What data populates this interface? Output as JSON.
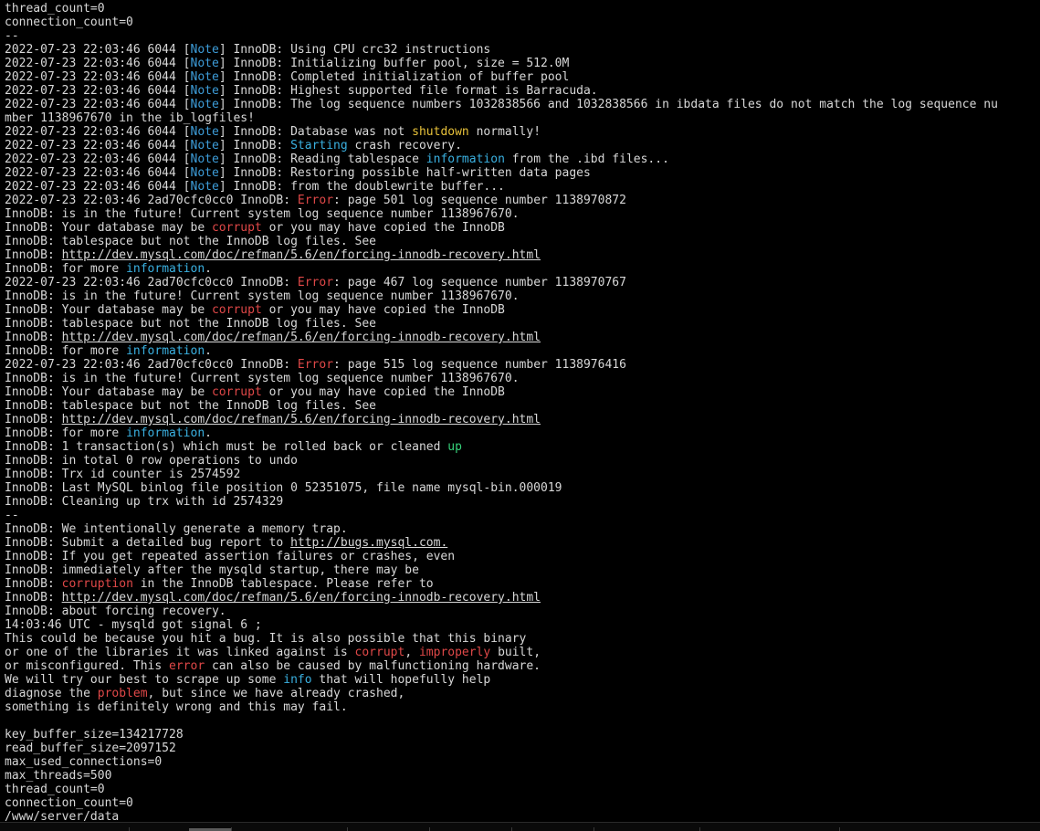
{
  "terminal": {
    "lines": [
      [
        {
          "t": "thread_count=0"
        }
      ],
      [
        {
          "t": "connection_count=0"
        }
      ],
      [
        {
          "t": "--"
        }
      ],
      [
        {
          "t": "2022-07-23 22:03:46 6044 ["
        },
        {
          "t": "Note",
          "c": "note"
        },
        {
          "t": "] InnoDB: Using CPU crc32 instructions"
        }
      ],
      [
        {
          "t": "2022-07-23 22:03:46 6044 ["
        },
        {
          "t": "Note",
          "c": "note"
        },
        {
          "t": "] InnoDB: Initializing buffer pool, size = 512.0M"
        }
      ],
      [
        {
          "t": "2022-07-23 22:03:46 6044 ["
        },
        {
          "t": "Note",
          "c": "note"
        },
        {
          "t": "] InnoDB: Completed initialization of buffer pool"
        }
      ],
      [
        {
          "t": "2022-07-23 22:03:46 6044 ["
        },
        {
          "t": "Note",
          "c": "note"
        },
        {
          "t": "] InnoDB: Highest supported file format is Barracuda."
        }
      ],
      [
        {
          "t": "2022-07-23 22:03:46 6044 ["
        },
        {
          "t": "Note",
          "c": "note"
        },
        {
          "t": "] InnoDB: The log sequence numbers 1032838566 and 1032838566 in ibdata files do not match the log sequence nu"
        }
      ],
      [
        {
          "t": "mber 1138967670 in the ib_logfiles!"
        }
      ],
      [
        {
          "t": "2022-07-23 22:03:46 6044 ["
        },
        {
          "t": "Note",
          "c": "note"
        },
        {
          "t": "] InnoDB: Database was not "
        },
        {
          "t": "shutdown",
          "c": "warn"
        },
        {
          "t": " normally!"
        }
      ],
      [
        {
          "t": "2022-07-23 22:03:46 6044 ["
        },
        {
          "t": "Note",
          "c": "note"
        },
        {
          "t": "] InnoDB: "
        },
        {
          "t": "Starting",
          "c": "info"
        },
        {
          "t": " crash recovery."
        }
      ],
      [
        {
          "t": "2022-07-23 22:03:46 6044 ["
        },
        {
          "t": "Note",
          "c": "note"
        },
        {
          "t": "] InnoDB: Reading tablespace "
        },
        {
          "t": "information",
          "c": "info"
        },
        {
          "t": " from the .ibd files..."
        }
      ],
      [
        {
          "t": "2022-07-23 22:03:46 6044 ["
        },
        {
          "t": "Note",
          "c": "note"
        },
        {
          "t": "] InnoDB: Restoring possible half-written data pages"
        }
      ],
      [
        {
          "t": "2022-07-23 22:03:46 6044 ["
        },
        {
          "t": "Note",
          "c": "note"
        },
        {
          "t": "] InnoDB: from the doublewrite buffer..."
        }
      ],
      [
        {
          "t": "2022-07-23 22:03:46 2ad70cfc0cc0 InnoDB: "
        },
        {
          "t": "Error",
          "c": "err"
        },
        {
          "t": ": page 501 log sequence number 1138970872"
        }
      ],
      [
        {
          "t": "InnoDB: is in the future! Current system log sequence number 1138967670."
        }
      ],
      [
        {
          "t": "InnoDB: Your database may be "
        },
        {
          "t": "corrupt",
          "c": "err"
        },
        {
          "t": " or you may have copied the InnoDB"
        }
      ],
      [
        {
          "t": "InnoDB: tablespace but not the InnoDB log files. See"
        }
      ],
      [
        {
          "t": "InnoDB: "
        },
        {
          "t": "http://dev.mysql.com/doc/refman/5.6/en/forcing-innodb-recovery.html",
          "c": "link"
        }
      ],
      [
        {
          "t": "InnoDB: for more "
        },
        {
          "t": "information",
          "c": "info"
        },
        {
          "t": "."
        }
      ],
      [
        {
          "t": "2022-07-23 22:03:46 2ad70cfc0cc0 InnoDB: "
        },
        {
          "t": "Error",
          "c": "err"
        },
        {
          "t": ": page 467 log sequence number 1138970767"
        }
      ],
      [
        {
          "t": "InnoDB: is in the future! Current system log sequence number 1138967670."
        }
      ],
      [
        {
          "t": "InnoDB: Your database may be "
        },
        {
          "t": "corrupt",
          "c": "err"
        },
        {
          "t": " or you may have copied the InnoDB"
        }
      ],
      [
        {
          "t": "InnoDB: tablespace but not the InnoDB log files. See"
        }
      ],
      [
        {
          "t": "InnoDB: "
        },
        {
          "t": "http://dev.mysql.com/doc/refman/5.6/en/forcing-innodb-recovery.html",
          "c": "link"
        }
      ],
      [
        {
          "t": "InnoDB: for more "
        },
        {
          "t": "information",
          "c": "info"
        },
        {
          "t": "."
        }
      ],
      [
        {
          "t": "2022-07-23 22:03:46 2ad70cfc0cc0 InnoDB: "
        },
        {
          "t": "Error",
          "c": "err"
        },
        {
          "t": ": page 515 log sequence number 1138976416"
        }
      ],
      [
        {
          "t": "InnoDB: is in the future! Current system log sequence number 1138967670."
        }
      ],
      [
        {
          "t": "InnoDB: Your database may be "
        },
        {
          "t": "corrupt",
          "c": "err"
        },
        {
          "t": " or you may have copied the InnoDB"
        }
      ],
      [
        {
          "t": "InnoDB: tablespace but not the InnoDB log files. See"
        }
      ],
      [
        {
          "t": "InnoDB: "
        },
        {
          "t": "http://dev.mysql.com/doc/refman/5.6/en/forcing-innodb-recovery.html",
          "c": "link"
        }
      ],
      [
        {
          "t": "InnoDB: for more "
        },
        {
          "t": "information",
          "c": "info"
        },
        {
          "t": "."
        }
      ],
      [
        {
          "t": "InnoDB: 1 transaction(s) which must be rolled back or cleaned "
        },
        {
          "t": "up",
          "c": "ok"
        }
      ],
      [
        {
          "t": "InnoDB: in total 0 row operations to undo"
        }
      ],
      [
        {
          "t": "InnoDB: Trx id counter is 2574592"
        }
      ],
      [
        {
          "t": "InnoDB: Last MySQL binlog file position 0 52351075, file name mysql-bin.000019"
        }
      ],
      [
        {
          "t": "InnoDB: Cleaning up trx with id 2574329"
        }
      ],
      [
        {
          "t": "--"
        }
      ],
      [
        {
          "t": "InnoDB: We intentionally generate a memory trap."
        }
      ],
      [
        {
          "t": "InnoDB: Submit a detailed bug report to "
        },
        {
          "t": "http://bugs.mysql.com.",
          "c": "link"
        }
      ],
      [
        {
          "t": "InnoDB: If you get repeated assertion failures or crashes, even"
        }
      ],
      [
        {
          "t": "InnoDB: immediately after the mysqld startup, there may be"
        }
      ],
      [
        {
          "t": "InnoDB: "
        },
        {
          "t": "corruption",
          "c": "err"
        },
        {
          "t": " in the InnoDB tablespace. Please refer to"
        }
      ],
      [
        {
          "t": "InnoDB: "
        },
        {
          "t": "http://dev.mysql.com/doc/refman/5.6/en/forcing-innodb-recovery.html",
          "c": "link"
        }
      ],
      [
        {
          "t": "InnoDB: about forcing recovery."
        }
      ],
      [
        {
          "t": "14:03:46 UTC - mysqld got signal 6 ;"
        }
      ],
      [
        {
          "t": "This could be because you hit a bug. It is also possible that this binary"
        }
      ],
      [
        {
          "t": "or one of the libraries it was linked against is "
        },
        {
          "t": "corrupt",
          "c": "err"
        },
        {
          "t": ", "
        },
        {
          "t": "improperly",
          "c": "err"
        },
        {
          "t": " built,"
        }
      ],
      [
        {
          "t": "or misconfigured. This "
        },
        {
          "t": "error",
          "c": "err"
        },
        {
          "t": " can also be caused by malfunctioning hardware."
        }
      ],
      [
        {
          "t": "We will try our best to scrape up some "
        },
        {
          "t": "info",
          "c": "info"
        },
        {
          "t": " that will hopefully help"
        }
      ],
      [
        {
          "t": "diagnose the "
        },
        {
          "t": "problem",
          "c": "err"
        },
        {
          "t": ", but since we have already crashed,"
        }
      ],
      [
        {
          "t": "something is definitely wrong and this may fail."
        }
      ],
      [
        {
          "t": ""
        }
      ],
      [
        {
          "t": "key_buffer_size=134217728"
        }
      ],
      [
        {
          "t": "read_buffer_size=2097152"
        }
      ],
      [
        {
          "t": "max_used_connections=0"
        }
      ],
      [
        {
          "t": "max_threads=500"
        }
      ],
      [
        {
          "t": "thread_count=0"
        }
      ],
      [
        {
          "t": "connection_count=0"
        }
      ],
      [
        {
          "t": "/www/server/data"
        }
      ]
    ],
    "colors": {
      "background": "#000000",
      "text": "#d8d8d8",
      "note": "#3d9cd8",
      "warn": "#e8c23a",
      "err": "#e04848",
      "info": "#3ab0e0",
      "ok": "#36d27a"
    }
  }
}
